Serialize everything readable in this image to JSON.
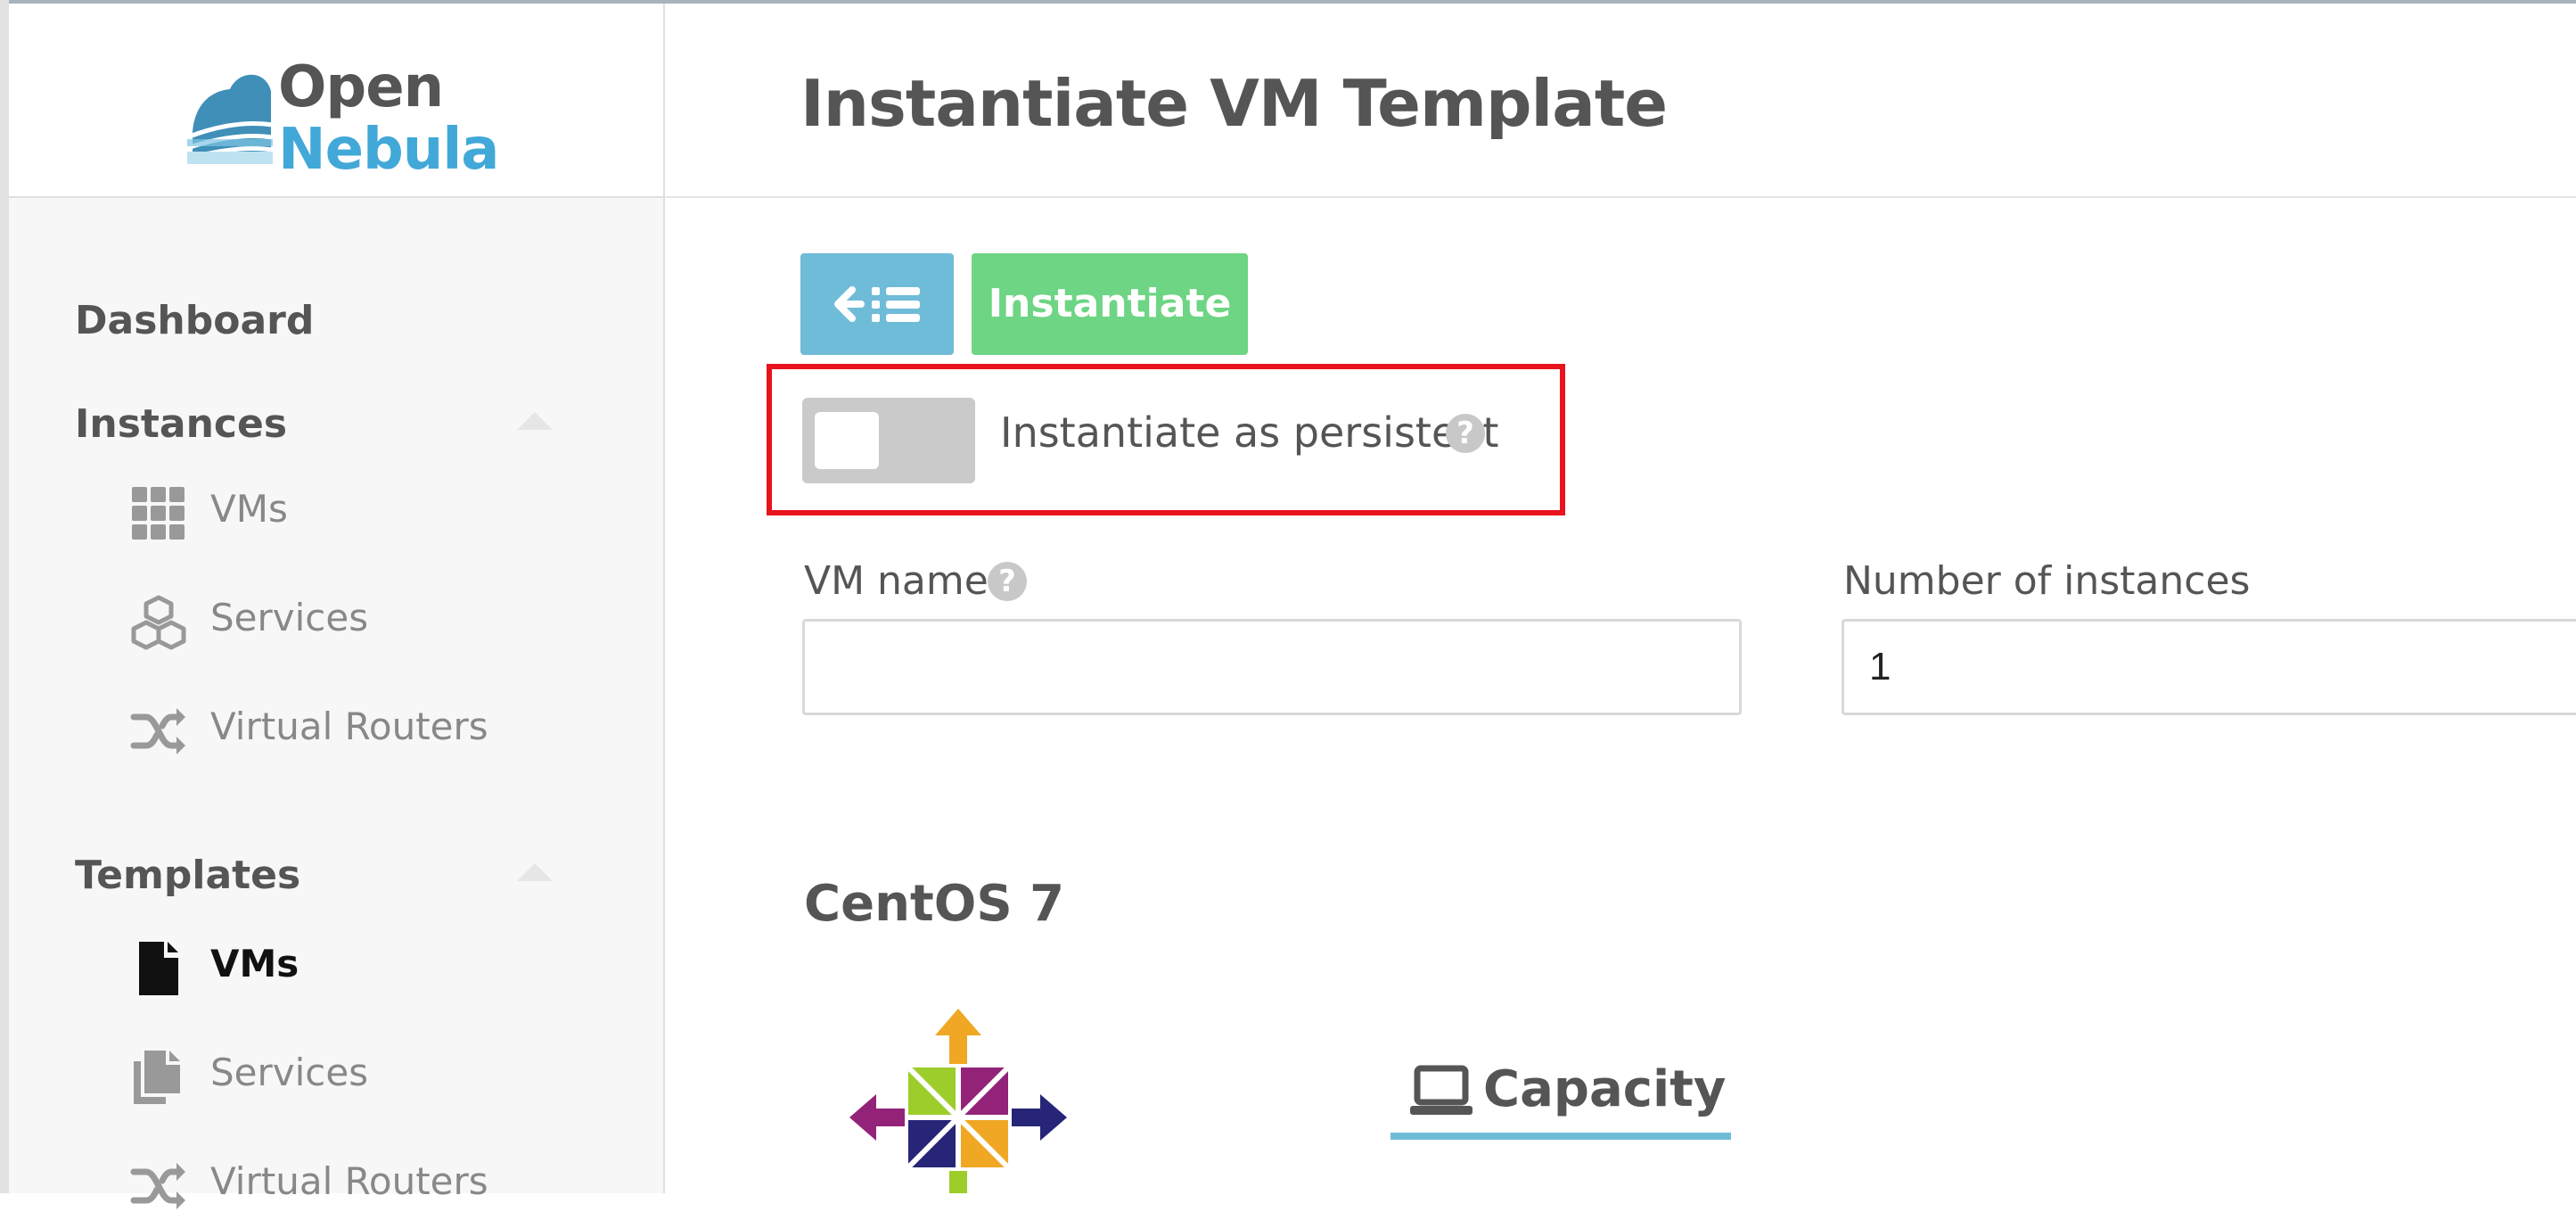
{
  "app": {
    "logo_line1": "Open",
    "logo_line2": "Nebula",
    "accent_color": "#6fbcd8",
    "success_color": "#6dd583",
    "highlight_color": "#e8131c"
  },
  "sidebar": {
    "dashboard": "Dashboard",
    "instances": {
      "title": "Instances",
      "items": [
        {
          "label": "VMs",
          "icon": "grid-icon"
        },
        {
          "label": "Services",
          "icon": "cubes-icon"
        },
        {
          "label": "Virtual Routers",
          "icon": "shuffle-icon"
        }
      ]
    },
    "templates": {
      "title": "Templates",
      "items": [
        {
          "label": "VMs",
          "icon": "file-icon",
          "active": true
        },
        {
          "label": "Services",
          "icon": "files-icon"
        },
        {
          "label": "Virtual Routers",
          "icon": "shuffle-icon"
        }
      ]
    }
  },
  "main": {
    "title": "Instantiate VM Template",
    "toolbar": {
      "back_icon": "back-to-list-icon",
      "instantiate_label": "Instantiate"
    },
    "persistent": {
      "label": "Instantiate as persistent",
      "enabled": false,
      "help": "?"
    },
    "vm_name": {
      "label": "VM name",
      "help": "?",
      "value": ""
    },
    "instances": {
      "label": "Number of instances",
      "value": "1"
    },
    "template": {
      "name": "CentOS 7",
      "capacity_tab": "Capacity"
    }
  }
}
